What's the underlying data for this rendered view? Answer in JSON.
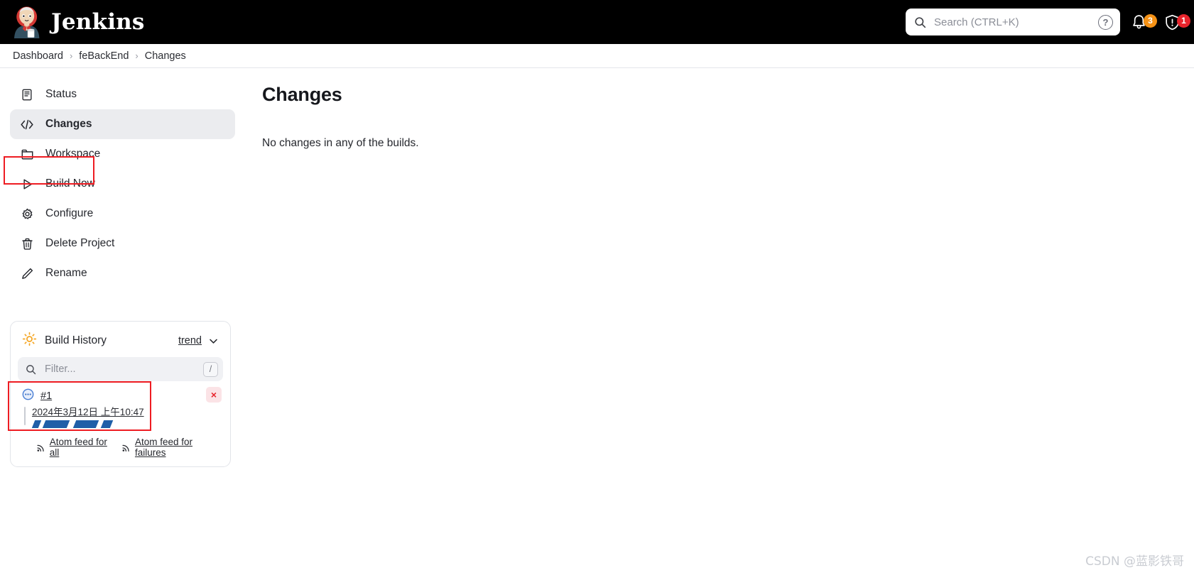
{
  "header": {
    "brand": "Jenkins",
    "search": {
      "placeholder": "Search (CTRL+K)",
      "value": "",
      "icon": "search-icon",
      "help_label": "?"
    },
    "notifications": {
      "icon": "bell-icon",
      "count": "3",
      "color": "#f59216"
    },
    "security": {
      "icon": "shield-warning-icon",
      "count": "1",
      "color": "#e8242c"
    }
  },
  "breadcrumb": {
    "items": [
      "Dashboard",
      "feBackEnd",
      "Changes"
    ],
    "separator": "›"
  },
  "sidebar": {
    "tasks": [
      {
        "label": "Status",
        "icon": "document-icon",
        "active": false
      },
      {
        "label": "Changes",
        "icon": "code-icon",
        "active": true
      },
      {
        "label": "Workspace",
        "icon": "folder-icon",
        "active": false
      },
      {
        "label": "Build Now",
        "icon": "play-icon",
        "active": false,
        "annotated": true
      },
      {
        "label": "Configure",
        "icon": "gear-icon",
        "active": false
      },
      {
        "label": "Delete Project",
        "icon": "trash-icon",
        "active": false
      },
      {
        "label": "Rename",
        "icon": "pencil-icon",
        "active": false
      }
    ],
    "build_history": {
      "title": "Build History",
      "weather_icon": "sun-icon",
      "trend_label": "trend",
      "trend_chevron": "chevron-down-icon",
      "filter": {
        "placeholder": "Filter...",
        "value": "",
        "icon": "search-icon",
        "shortcut": "/"
      },
      "builds": [
        {
          "number": "#1",
          "status_icon": "in-progress-icon",
          "date": "2024年3月12日 上午10:47",
          "delete_label": "×",
          "annotated": true
        }
      ],
      "feeds": [
        {
          "label": "Atom feed for all",
          "icon": "rss-icon"
        },
        {
          "label": "Atom feed for failures",
          "icon": "rss-icon"
        }
      ]
    }
  },
  "main": {
    "title": "Changes",
    "empty_message": "No changes in any of the builds."
  },
  "watermark": "CSDN @蓝影铁哥"
}
